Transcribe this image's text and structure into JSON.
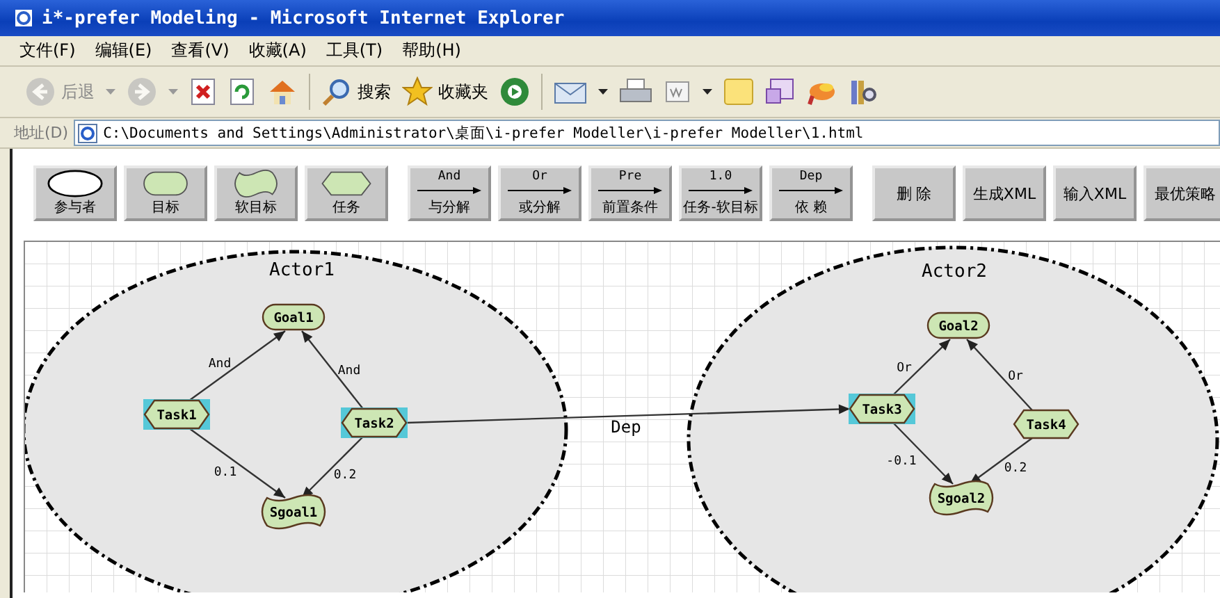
{
  "window": {
    "title": "i*-prefer Modeling - Microsoft Internet Explorer"
  },
  "menu": [
    "文件(F)",
    "编辑(E)",
    "查看(V)",
    "收藏(A)",
    "工具(T)",
    "帮助(H)"
  ],
  "toolbar": [
    {
      "kind": "back",
      "label": "后退",
      "disabled": true,
      "dropdown": true
    },
    {
      "kind": "forward",
      "disabled": true,
      "dropdown": true
    },
    {
      "kind": "stop",
      "disabled": false
    },
    {
      "kind": "refresh",
      "disabled": false
    },
    {
      "kind": "home",
      "disabled": false
    },
    {
      "kind": "search",
      "label": "搜索",
      "disabled": false
    },
    {
      "kind": "favorites",
      "label": "收藏夹",
      "disabled": false
    },
    {
      "kind": "media",
      "disabled": false
    },
    {
      "kind": "mail",
      "disabled": false,
      "dropdown": true
    },
    {
      "kind": "print",
      "disabled": false
    },
    {
      "kind": "edit",
      "disabled": false,
      "dropdown": true
    },
    {
      "kind": "note",
      "disabled": false
    },
    {
      "kind": "messenger",
      "disabled": false
    },
    {
      "kind": "tool",
      "disabled": false
    },
    {
      "kind": "research",
      "disabled": false
    }
  ],
  "address": {
    "label": "地址(D)",
    "value": "C:\\Documents and Settings\\Administrator\\桌面\\i-prefer Modeller\\i-prefer Modeller\\1.html"
  },
  "palette": [
    [
      {
        "kind": "actor",
        "label": "参与者"
      },
      {
        "kind": "goal",
        "label": "目标"
      },
      {
        "kind": "softgoal",
        "label": "软目标"
      },
      {
        "kind": "task",
        "label": "任务"
      }
    ],
    [
      {
        "kind": "link",
        "symbol": "And",
        "label": "与分解"
      },
      {
        "kind": "link",
        "symbol": "Or",
        "label": "或分解"
      },
      {
        "kind": "link",
        "symbol": "Pre",
        "label": "前置条件"
      },
      {
        "kind": "link",
        "symbol": "1.0",
        "label": "任务-软目标"
      },
      {
        "kind": "link",
        "symbol": "Dep",
        "label": "依 赖"
      }
    ],
    [
      {
        "kind": "action",
        "label": "删 除"
      },
      {
        "kind": "action",
        "label": "生成XML"
      },
      {
        "kind": "action",
        "label": "输入XML"
      },
      {
        "kind": "action",
        "label": "最优策略"
      }
    ]
  ],
  "diagram": {
    "actors": [
      {
        "name": "Actor1"
      },
      {
        "name": "Actor2"
      }
    ],
    "nodes": [
      {
        "label": "Goal1",
        "kind": "goal",
        "selected": false
      },
      {
        "label": "Task1",
        "kind": "task",
        "selected": true
      },
      {
        "label": "Task2",
        "kind": "task",
        "selected": true
      },
      {
        "label": "Sgoal1",
        "kind": "softgoal",
        "selected": false
      },
      {
        "label": "Goal2",
        "kind": "goal",
        "selected": false
      },
      {
        "label": "Task3",
        "kind": "task",
        "selected": true
      },
      {
        "label": "Task4",
        "kind": "task",
        "selected": false
      },
      {
        "label": "Sgoal2",
        "kind": "softgoal",
        "selected": false
      }
    ],
    "links": [
      {
        "label": "And"
      },
      {
        "label": "And"
      },
      {
        "label": "0.1"
      },
      {
        "label": "0.2"
      },
      {
        "label": "Dep"
      },
      {
        "label": "Or"
      },
      {
        "label": "Or"
      },
      {
        "label": "-0.1"
      },
      {
        "label": "0.2"
      }
    ]
  }
}
